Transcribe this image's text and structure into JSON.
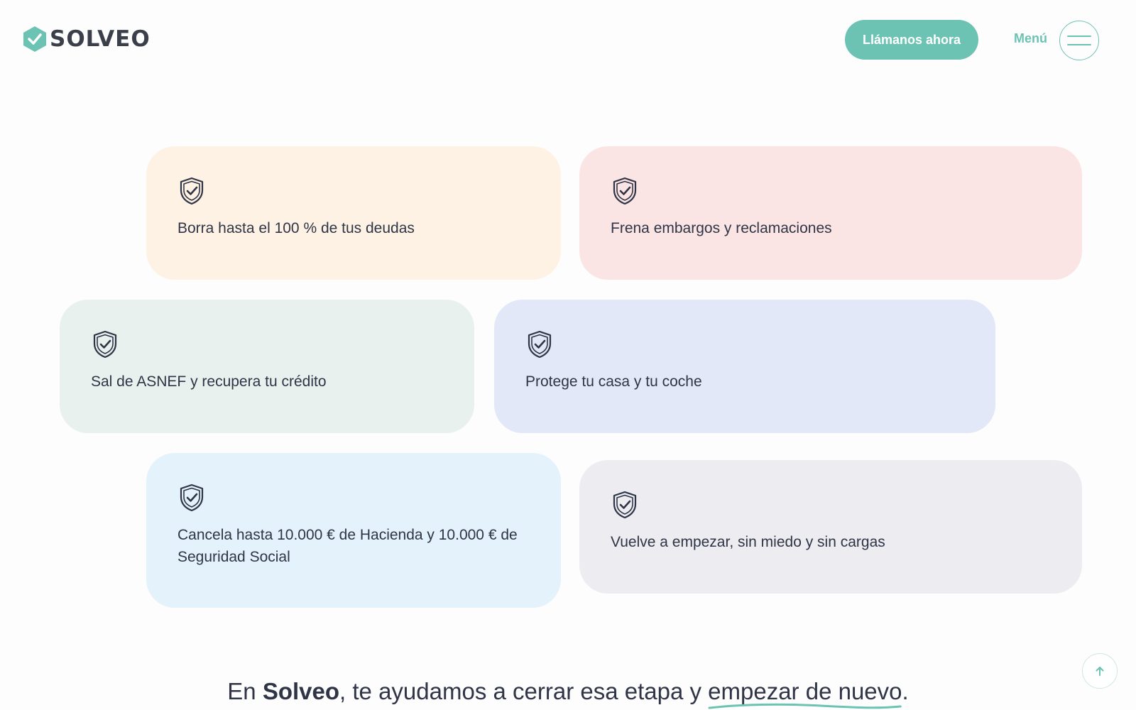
{
  "header": {
    "logo_text": "SOLVEO",
    "cta_label": "Llámanos ahora",
    "menu_label": "Menú"
  },
  "cards": [
    {
      "label": "Borra hasta el 100 % de tus deudas",
      "color": "#fef2e4"
    },
    {
      "label": "Frena embargos y reclamaciones",
      "color": "#fbe5e4"
    },
    {
      "label": "Sal de ASNEF y recupera tu crédito",
      "color": "#e8f1ed"
    },
    {
      "label": "Protege tu casa y tu coche",
      "color": "#e3e8f8"
    },
    {
      "label": "Cancela hasta 10.000 € de Hacienda y 10.000 € de Seguridad Social",
      "color": "#e3f2fb"
    },
    {
      "label": "Vuelve a empezar, sin miedo y sin cargas",
      "color": "#ececf1"
    }
  ],
  "tagline": {
    "prefix": "En ",
    "brand": "Solveo",
    "middle": ", te ayudamos a cerrar esa etapa y ",
    "highlight": "empezar de nuevo",
    "suffix": "."
  },
  "icons": {
    "logo": "check-hexagon-icon",
    "card": "shield-check-icon",
    "menu": "hamburger-icon",
    "scroll_top": "arrow-up-icon"
  },
  "colors": {
    "accent": "#6cc3b3",
    "text": "#2f3546"
  }
}
